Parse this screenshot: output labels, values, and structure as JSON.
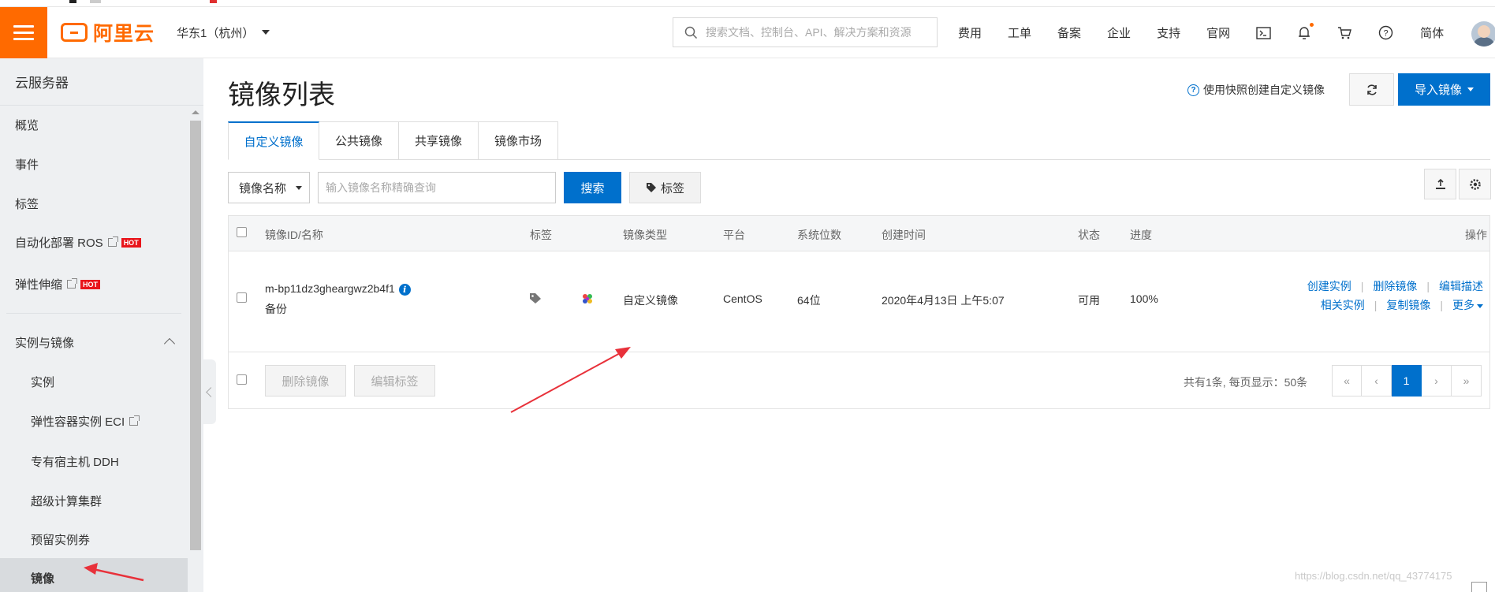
{
  "header": {
    "logo_text": "阿里云",
    "region": "华东1（杭州）",
    "search_placeholder": "搜索文档、控制台、API、解决方案和资源",
    "nav": [
      "费用",
      "工单",
      "备案",
      "企业",
      "支持",
      "官网"
    ],
    "language": "简体",
    "icons": [
      "terminal-icon",
      "bell-icon",
      "cart-icon",
      "help-icon"
    ]
  },
  "sidebar": {
    "title": "云服务器",
    "items": [
      {
        "label": "概览"
      },
      {
        "label": "事件"
      },
      {
        "label": "标签"
      },
      {
        "label": "自动化部署 ROS",
        "badge": "HOT"
      },
      {
        "label": "弹性伸缩",
        "badge": "HOT"
      }
    ],
    "group": {
      "label": "实例与镜像",
      "children": [
        {
          "label": "实例"
        },
        {
          "label": "弹性容器实例 ECI"
        },
        {
          "label": "专有宿主机 DDH"
        },
        {
          "label": "超级计算集群"
        },
        {
          "label": "预留实例券"
        },
        {
          "label": "镜像",
          "active": true
        }
      ]
    }
  },
  "page": {
    "title": "镜像列表",
    "help_link": "使用快照创建自定义镜像",
    "import_button": "导入镜像",
    "tabs": [
      "自定义镜像",
      "公共镜像",
      "共享镜像",
      "镜像市场"
    ],
    "filter": {
      "select_value": "镜像名称",
      "input_placeholder": "输入镜像名称精确查询",
      "search_button": "搜索",
      "tag_button": "标签"
    }
  },
  "table": {
    "columns": [
      "镜像ID/名称",
      "标签",
      "镜像类型",
      "平台",
      "系统位数",
      "创建时间",
      "状态",
      "进度",
      "操作"
    ],
    "rows": [
      {
        "id": "m-bp11dz3gheargwz2b4f1",
        "name": "备份",
        "type": "自定义镜像",
        "platform": "CentOS",
        "bits": "64位",
        "created": "2020年4月13日 上午5:07",
        "status": "可用",
        "progress": "100%",
        "actions_row1": [
          "创建实例",
          "删除镜像",
          "编辑描述"
        ],
        "actions_row2": [
          "相关实例",
          "复制镜像",
          "更多"
        ]
      }
    ],
    "footer": {
      "delete_button": "删除镜像",
      "edit_tags_button": "编辑标签",
      "summary": "共有1条, 每页显示：50条",
      "pages": [
        "«",
        "‹",
        "1",
        "›",
        "»"
      ],
      "current_page": "1"
    }
  },
  "watermark": "https://blog.csdn.net/qq_43774175",
  "colors": {
    "brand": "#ff6a00",
    "primary": "#0070cc",
    "annotation": "#e8313a"
  }
}
